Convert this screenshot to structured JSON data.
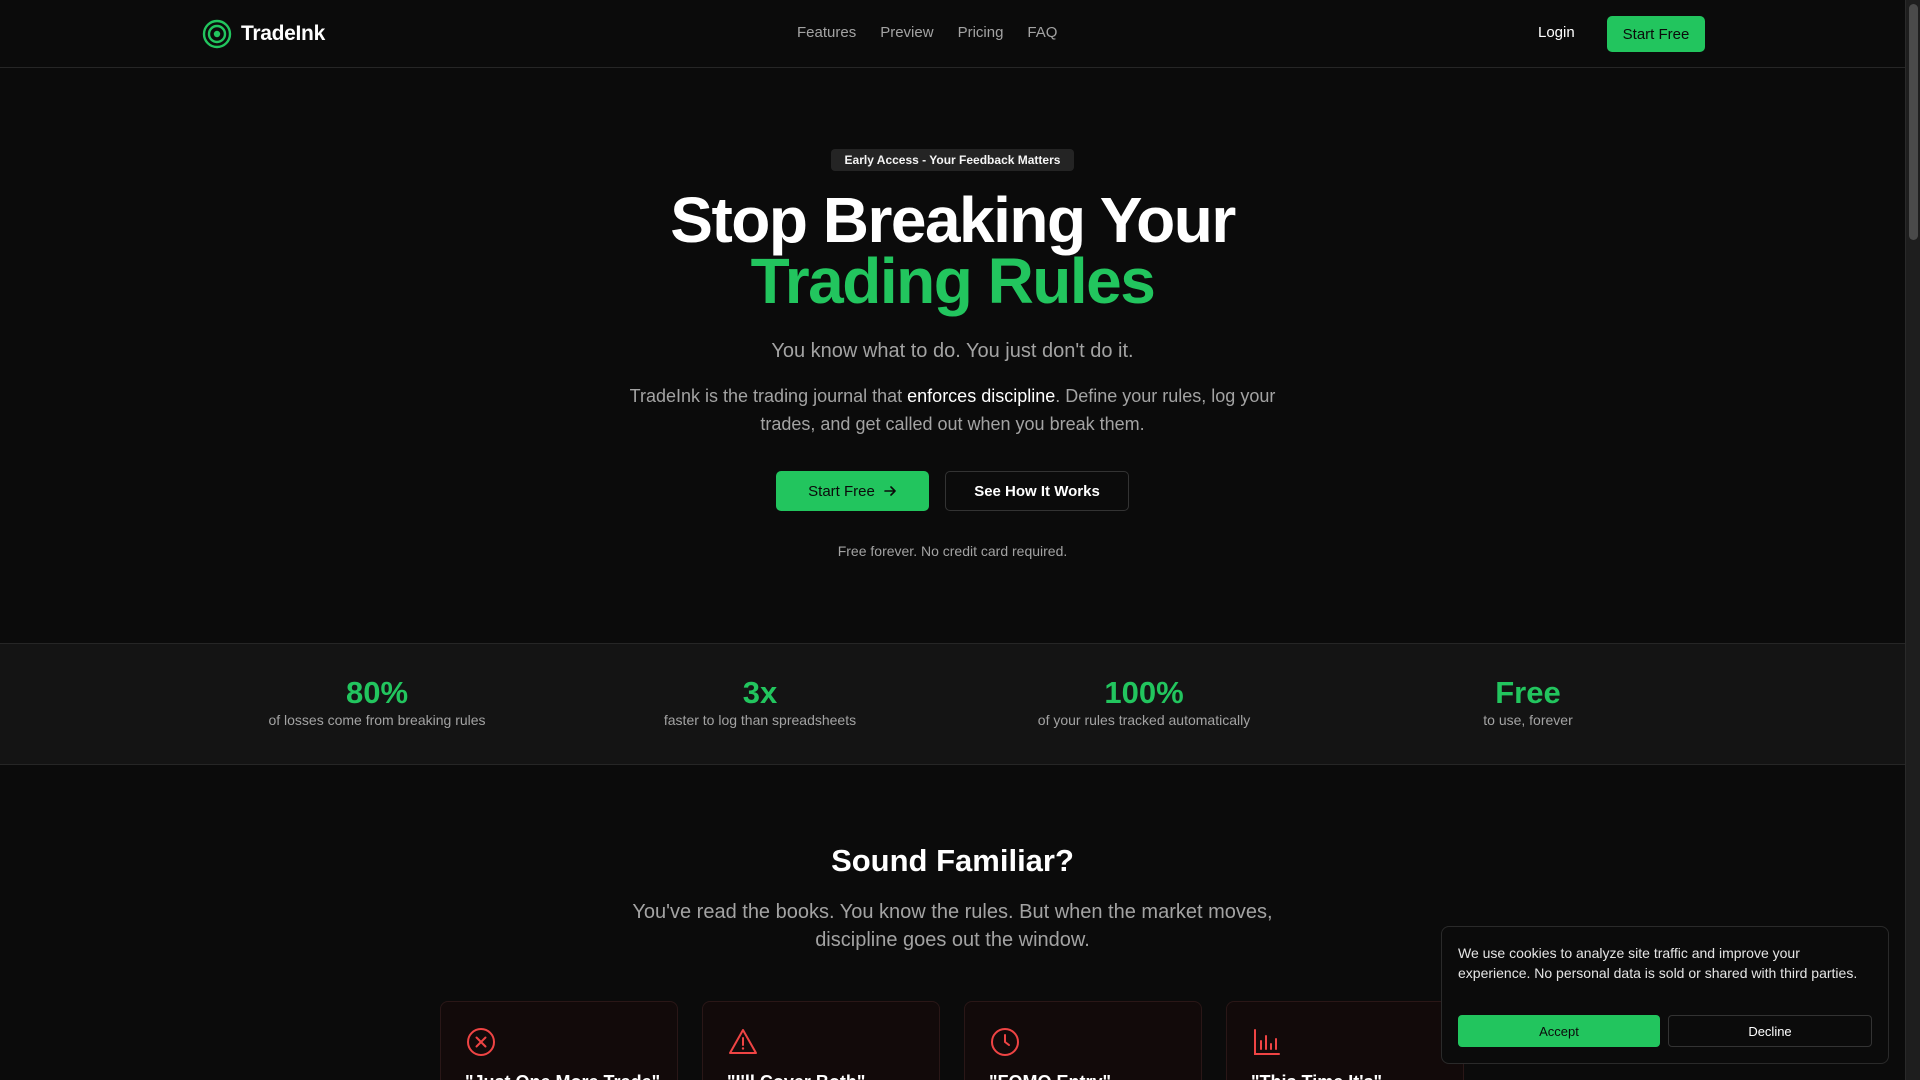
{
  "brand": {
    "name": "TradeInk",
    "accent": "#22c55e"
  },
  "nav": {
    "items": [
      "Features",
      "Preview",
      "Pricing",
      "FAQ"
    ]
  },
  "header": {
    "login_label": "Login",
    "start_label": "Start Free"
  },
  "hero": {
    "badge": "Early Access - Your Feedback Matters",
    "headline_line1": "Stop Breaking Your",
    "headline_line2": "Trading Rules",
    "tagline": "You know what to do. You just don't do it.",
    "desc_pre": "TradeInk is the trading journal that ",
    "desc_strong": "enforces discipline",
    "desc_post": ". Define your rules, log your trades, and get called out when you break them.",
    "primary_label": "Start Free",
    "primary_icon": "arrow-right-icon",
    "secondary_label": "See How It Works",
    "fine_print": "Free forever. No credit card required."
  },
  "stats": [
    {
      "value": "80%",
      "label": "of losses come from breaking rules"
    },
    {
      "value": "3x",
      "label": "faster to log than spreadsheets"
    },
    {
      "value": "100%",
      "label": "of your rules tracked automatically"
    },
    {
      "value": "Free",
      "label": "to use, forever"
    }
  ],
  "familiar": {
    "title": "Sound Familiar?",
    "subtitle": "You've read the books. You know the rules. But when the market moves, discipline goes out the window.",
    "cards": [
      {
        "icon": "x-circle-icon",
        "quote": "\"Just One More Trade\""
      },
      {
        "icon": "warning-triangle-icon",
        "quote": "\"I'll Cover Both\""
      },
      {
        "icon": "clock-icon",
        "quote": "\"FOMO Entry\""
      },
      {
        "icon": "bar-chart-icon",
        "quote": "\"This Time It's\""
      }
    ]
  },
  "cookie": {
    "text": "We use cookies to analyze site traffic and improve your experience. No personal data is sold or shared with third parties.",
    "accept_label": "Accept",
    "decline_label": "Decline"
  }
}
